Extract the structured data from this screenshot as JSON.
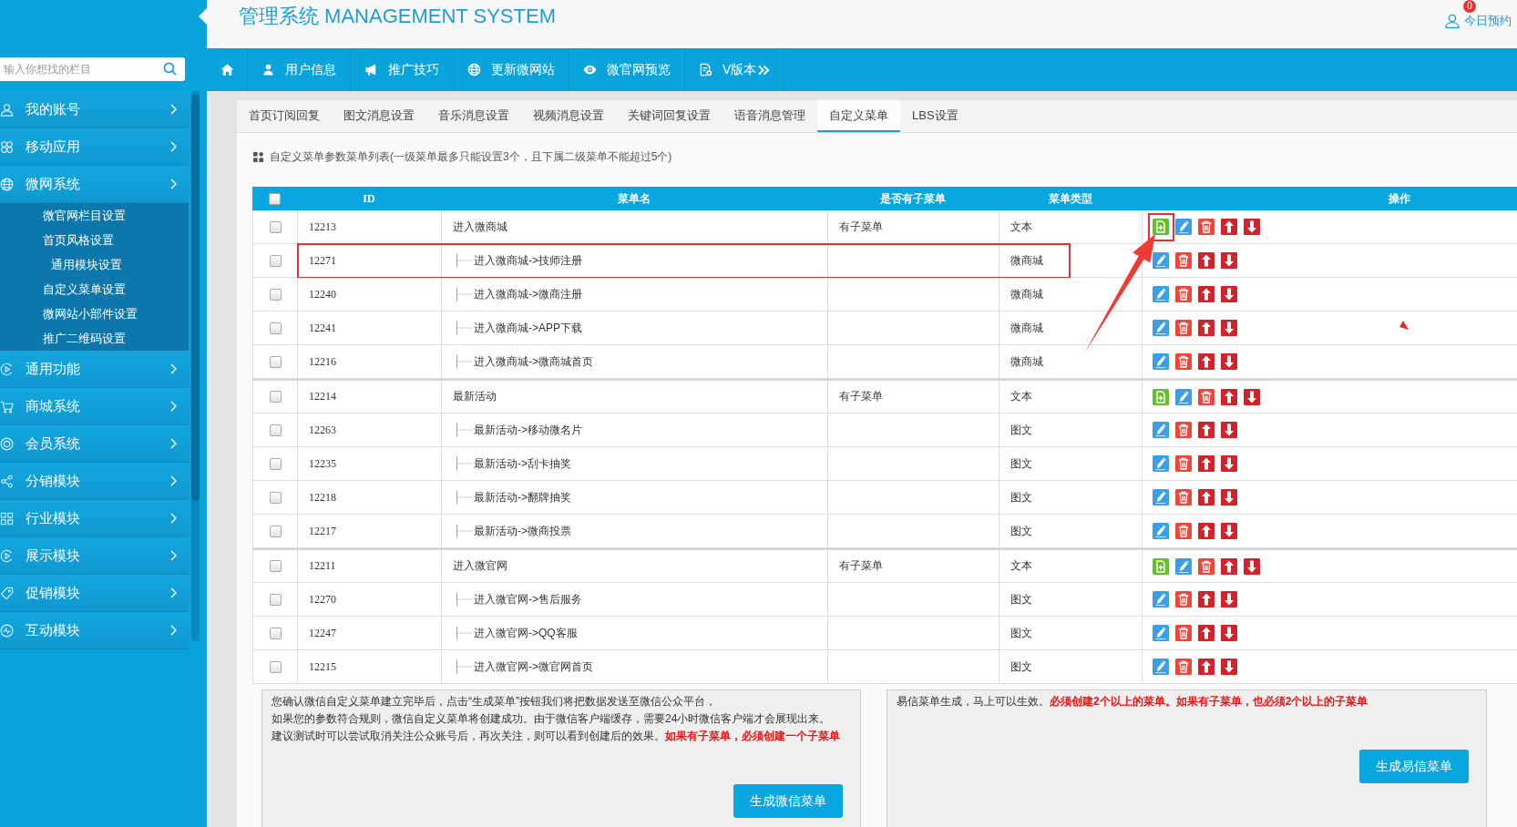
{
  "header": {
    "title": "管理系统 MANAGEMENT SYSTEM",
    "badge": "0",
    "link": "今日预约"
  },
  "sidebar": {
    "search": {
      "placeholder": "输入你想找的栏目"
    },
    "menu": [
      {
        "label": "我的账号"
      },
      {
        "label": "移动应用"
      },
      {
        "label": "微网系统",
        "children": [
          {
            "label": "微官网栏目设置"
          },
          {
            "label": "首页风格设置",
            "children": [
              {
                "label": "通用模块设置"
              }
            ]
          },
          {
            "label": "自定义菜单设置"
          },
          {
            "label": "微网站小部件设置"
          },
          {
            "label": "推广二维码设置"
          }
        ]
      },
      {
        "label": "通用功能"
      },
      {
        "label": "商城系统"
      },
      {
        "label": "会员系统"
      },
      {
        "label": "分销模块"
      },
      {
        "label": "行业模块"
      },
      {
        "label": "展示模块"
      },
      {
        "label": "促销模块"
      },
      {
        "label": "互动模块"
      }
    ]
  },
  "nav": [
    "用户信息",
    "推广技巧",
    "更新微网站",
    "微官网预览",
    "V版本"
  ],
  "tabs": [
    {
      "label": "首页订阅回复",
      "selected": false
    },
    {
      "label": "图文消息设置",
      "selected": false
    },
    {
      "label": "音乐消息设置",
      "selected": false
    },
    {
      "label": "视频消息设置",
      "selected": false
    },
    {
      "label": "关键词回复设置",
      "selected": false
    },
    {
      "label": "语音消息管理",
      "selected": false
    },
    {
      "label": "自定义菜单",
      "selected": true
    },
    {
      "label": "LBS设置",
      "selected": false
    }
  ],
  "info": "自定义菜单参数菜单列表(一级菜单最多只能设置3个，且下属二级菜单不能超过5个)",
  "table": {
    "all_checked": false,
    "columns": [
      "ID",
      "菜单名",
      "是否有子菜单",
      "菜单类型",
      "操作"
    ],
    "rows": [
      {
        "id": "12213",
        "name": "进入微商城",
        "has_submenu": "有子菜单",
        "type": "文本",
        "checked": false,
        "marked": false,
        "actions": [
          {
            "kind": "add",
            "marked": true
          },
          {
            "kind": "edit",
            "marked": false
          },
          {
            "kind": "delete",
            "marked": false
          },
          {
            "kind": "up",
            "marked": false
          },
          {
            "kind": "down",
            "marked": false
          }
        ],
        "children": [
          {
            "id": "12271",
            "name": "进入微商城->技师注册",
            "type": "微商城",
            "checked": false,
            "marked": true,
            "actions": [
              {
                "kind": "edit",
                "marked": false
              },
              {
                "kind": "delete",
                "marked": false
              },
              {
                "kind": "up",
                "marked": false
              },
              {
                "kind": "down",
                "marked": false
              }
            ]
          },
          {
            "id": "12240",
            "name": "进入微商城->微商注册",
            "type": "微商城",
            "checked": false,
            "marked": false,
            "actions": [
              {
                "kind": "edit",
                "marked": false
              },
              {
                "kind": "delete",
                "marked": false
              },
              {
                "kind": "up",
                "marked": false
              },
              {
                "kind": "down",
                "marked": false
              }
            ]
          },
          {
            "id": "12241",
            "name": "进入微商城->APP下载",
            "type": "微商城",
            "checked": false,
            "marked": false,
            "actions": [
              {
                "kind": "edit",
                "marked": false
              },
              {
                "kind": "delete",
                "marked": false
              },
              {
                "kind": "up",
                "marked": false
              },
              {
                "kind": "down",
                "marked": false
              }
            ]
          },
          {
            "id": "12216",
            "name": "进入微商城->微商城首页",
            "type": "微商城",
            "checked": false,
            "marked": false,
            "actions": [
              {
                "kind": "edit",
                "marked": false
              },
              {
                "kind": "delete",
                "marked": false
              },
              {
                "kind": "up",
                "marked": false
              },
              {
                "kind": "down",
                "marked": false
              }
            ]
          }
        ]
      },
      {
        "id": "12214",
        "name": "最新活动",
        "has_submenu": "有子菜单",
        "type": "文本",
        "checked": false,
        "marked": false,
        "actions": [
          {
            "kind": "add",
            "marked": false
          },
          {
            "kind": "edit",
            "marked": false
          },
          {
            "kind": "delete",
            "marked": false
          },
          {
            "kind": "up",
            "marked": false
          },
          {
            "kind": "down",
            "marked": false
          }
        ],
        "children": [
          {
            "id": "12263",
            "name": "最新活动->移动微名片",
            "type": "图文",
            "checked": false,
            "marked": false,
            "actions": [
              {
                "kind": "edit",
                "marked": false
              },
              {
                "kind": "delete",
                "marked": false
              },
              {
                "kind": "up",
                "marked": false
              },
              {
                "kind": "down",
                "marked": false
              }
            ]
          },
          {
            "id": "12235",
            "name": "最新活动->刮卡抽奖",
            "type": "图文",
            "checked": false,
            "marked": false,
            "actions": [
              {
                "kind": "edit",
                "marked": false
              },
              {
                "kind": "delete",
                "marked": false
              },
              {
                "kind": "up",
                "marked": false
              },
              {
                "kind": "down",
                "marked": false
              }
            ]
          },
          {
            "id": "12218",
            "name": "最新活动->翻牌抽奖",
            "type": "图文",
            "checked": false,
            "marked": false,
            "actions": [
              {
                "kind": "edit",
                "marked": false
              },
              {
                "kind": "delete",
                "marked": false
              },
              {
                "kind": "up",
                "marked": false
              },
              {
                "kind": "down",
                "marked": false
              }
            ]
          },
          {
            "id": "12217",
            "name": "最新活动->微商投票",
            "type": "图文",
            "checked": false,
            "marked": false,
            "actions": [
              {
                "kind": "edit",
                "marked": false
              },
              {
                "kind": "delete",
                "marked": false
              },
              {
                "kind": "up",
                "marked": false
              },
              {
                "kind": "down",
                "marked": false
              }
            ]
          }
        ]
      },
      {
        "id": "12211",
        "name": "进入微官网",
        "has_submenu": "有子菜单",
        "type": "文本",
        "checked": false,
        "marked": false,
        "actions": [
          {
            "kind": "add",
            "marked": false
          },
          {
            "kind": "edit",
            "marked": false
          },
          {
            "kind": "delete",
            "marked": false
          },
          {
            "kind": "up",
            "marked": false
          },
          {
            "kind": "down",
            "marked": false
          }
        ],
        "children": [
          {
            "id": "12270",
            "name": "进入微官网->售后服务",
            "type": "图文",
            "checked": false,
            "marked": false,
            "actions": [
              {
                "kind": "edit",
                "marked": false
              },
              {
                "kind": "delete",
                "marked": false
              },
              {
                "kind": "up",
                "marked": false
              },
              {
                "kind": "down",
                "marked": false
              }
            ]
          },
          {
            "id": "12247",
            "name": "进入微官网->QQ客服",
            "type": "图文",
            "checked": false,
            "marked": false,
            "actions": [
              {
                "kind": "edit",
                "marked": false
              },
              {
                "kind": "delete",
                "marked": false
              },
              {
                "kind": "up",
                "marked": false
              },
              {
                "kind": "down",
                "marked": false
              }
            ]
          },
          {
            "id": "12215",
            "name": "进入微官网->微官网首页",
            "type": "图文",
            "checked": false,
            "marked": false,
            "actions": [
              {
                "kind": "edit",
                "marked": false
              },
              {
                "kind": "delete",
                "marked": false
              },
              {
                "kind": "up",
                "marked": false
              },
              {
                "kind": "down",
                "marked": false
              }
            ]
          }
        ]
      }
    ]
  },
  "panels": [
    {
      "lines": [
        "您确认微信自定义菜单建立完毕后，点击“生成菜单”按钮我们将把数据发送至微信公众平台，",
        "如果您的参数符合规则，微信自定义菜单将创建成功。由于微信客户端缓存，需要24小时微信客户端才会展现出来。",
        "建议测试时可以尝试取消关注公众账号后，再次关注，则可以看到创建后的效果。"
      ],
      "alert": "如果有子菜单，必须创建一个子菜单",
      "button": "生成微信菜单"
    },
    {
      "lines": [
        "易信菜单生成，马上可以生效。"
      ],
      "alert": "必须创建2个以上的菜单。如果有子菜单，也必须2个以上的子菜单",
      "button": "生成易信菜单"
    }
  ]
}
